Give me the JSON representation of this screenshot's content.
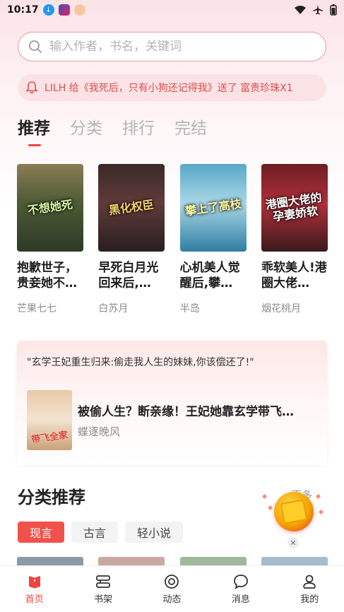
{
  "status_bar": {
    "time": "10:17"
  },
  "search": {
    "placeholder": "输入作者，书名，关键词"
  },
  "notice": {
    "text": "LILH 给《我死后，只有小狗还记得我》送了 富贵珍珠X1"
  },
  "tabs": [
    {
      "label": "推荐",
      "active": true
    },
    {
      "label": "分类"
    },
    {
      "label": "排行"
    },
    {
      "label": "完结"
    }
  ],
  "books": [
    {
      "cover_text": "不想她死",
      "title": "抱歉世子，贵妾她不…",
      "author": "芒果七七"
    },
    {
      "cover_text": "黑化权臣",
      "title": "早死白月光回来后,…",
      "author": "白苏月"
    },
    {
      "cover_text": "攀上了高枝",
      "title": "心机美人觉醒后,攀…",
      "author": "半岛"
    },
    {
      "cover_text": "港圈大佬的孕妻娇软",
      "title": "乖软美人!港圈大佬…",
      "author": "烟花桃月"
    }
  ],
  "featured": {
    "quote": "\"玄学王妃重生归来:偷走我人生的妹妹,你该偿还了!\"",
    "cover_text": "带飞全家",
    "title": "被偷人生？断亲缘！王妃她靠玄学带飞…",
    "author": "蝶逐晚风"
  },
  "category_section": {
    "title": "分类推荐",
    "more": "更多",
    "chips": [
      {
        "label": "现言",
        "active": true
      },
      {
        "label": "古言"
      },
      {
        "label": "轻小说"
      }
    ]
  },
  "nav": [
    {
      "label": "首页",
      "icon": "home-book-icon",
      "active": true
    },
    {
      "label": "书架",
      "icon": "bookshelf-icon"
    },
    {
      "label": "动态",
      "icon": "activity-circle-icon"
    },
    {
      "label": "消息",
      "icon": "message-bubble-icon"
    },
    {
      "label": "我的",
      "icon": "profile-icon"
    }
  ],
  "colors": {
    "accent": "#f0443e",
    "notice_text": "#e04a4a",
    "notice_bg": "#fbe3e5"
  }
}
